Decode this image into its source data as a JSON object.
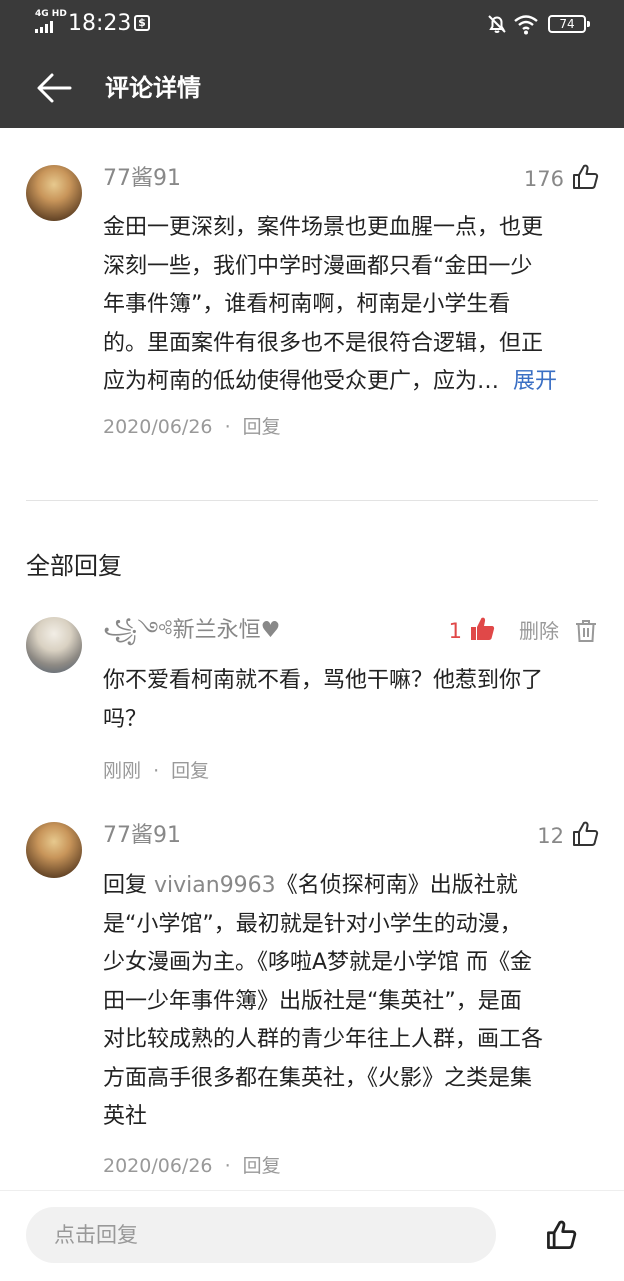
{
  "status_bar": {
    "network": "4G HD",
    "time": "18:23",
    "battery": "74"
  },
  "header": {
    "title": "评论详情"
  },
  "main_comment": {
    "username": "77酱91",
    "likes": "176",
    "lines": [
      "金田一更深刻，案件场景也更血腥一点，也更",
      "深刻一些，我们中学时漫画都只看“金田一少",
      "年事件簿”，谁看柯南啊，柯南是小学生看",
      "的。里面案件有很多也不是很符合逻辑，但正",
      "应为柯南的低幼使得他受众更广，应为…"
    ],
    "expand_label": "展开",
    "date": "2020/06/26",
    "separator": "·",
    "reply_label": "回复"
  },
  "replies_section": {
    "title": "全部回复"
  },
  "replies": [
    {
      "username": "꧁༺新兰永恒♥",
      "likes": "1",
      "delete_label": "删除",
      "lines": [
        "你不爱看柯南就不看，骂他干嘛？他惹到你了",
        "吗？"
      ],
      "time": "刚刚",
      "separator": "·",
      "reply_label": "回复"
    },
    {
      "username": "77酱91",
      "likes": "12",
      "reply_prefix": "回复 ",
      "reply_to": "vivian9963",
      "lines": [
        "《名侦探柯南》出版社就",
        "是“小学馆”，最初就是针对小学生的动漫，",
        "少女漫画为主。《哆啦A梦就是小学馆 而《金",
        "田一少年事件簿》出版社是“集英社”，是面",
        "对比较成熟的人群的青少年往上人群，画工各",
        "方面高手很多都在集英社，《火影》之类是集",
        "英社"
      ],
      "date": "2020/06/26",
      "separator": "·",
      "reply_label": "回复"
    }
  ],
  "bottom_bar": {
    "placeholder": "点击回复"
  },
  "colors": {
    "header_bg": "#3a3a3a",
    "accent_blue": "#3a6fc4",
    "like_red": "#e04848",
    "muted": "#999999"
  },
  "icons": [
    "back-arrow-icon",
    "thumbs-up-icon",
    "trash-icon",
    "bell-muted-icon",
    "wifi-icon",
    "battery-icon"
  ]
}
